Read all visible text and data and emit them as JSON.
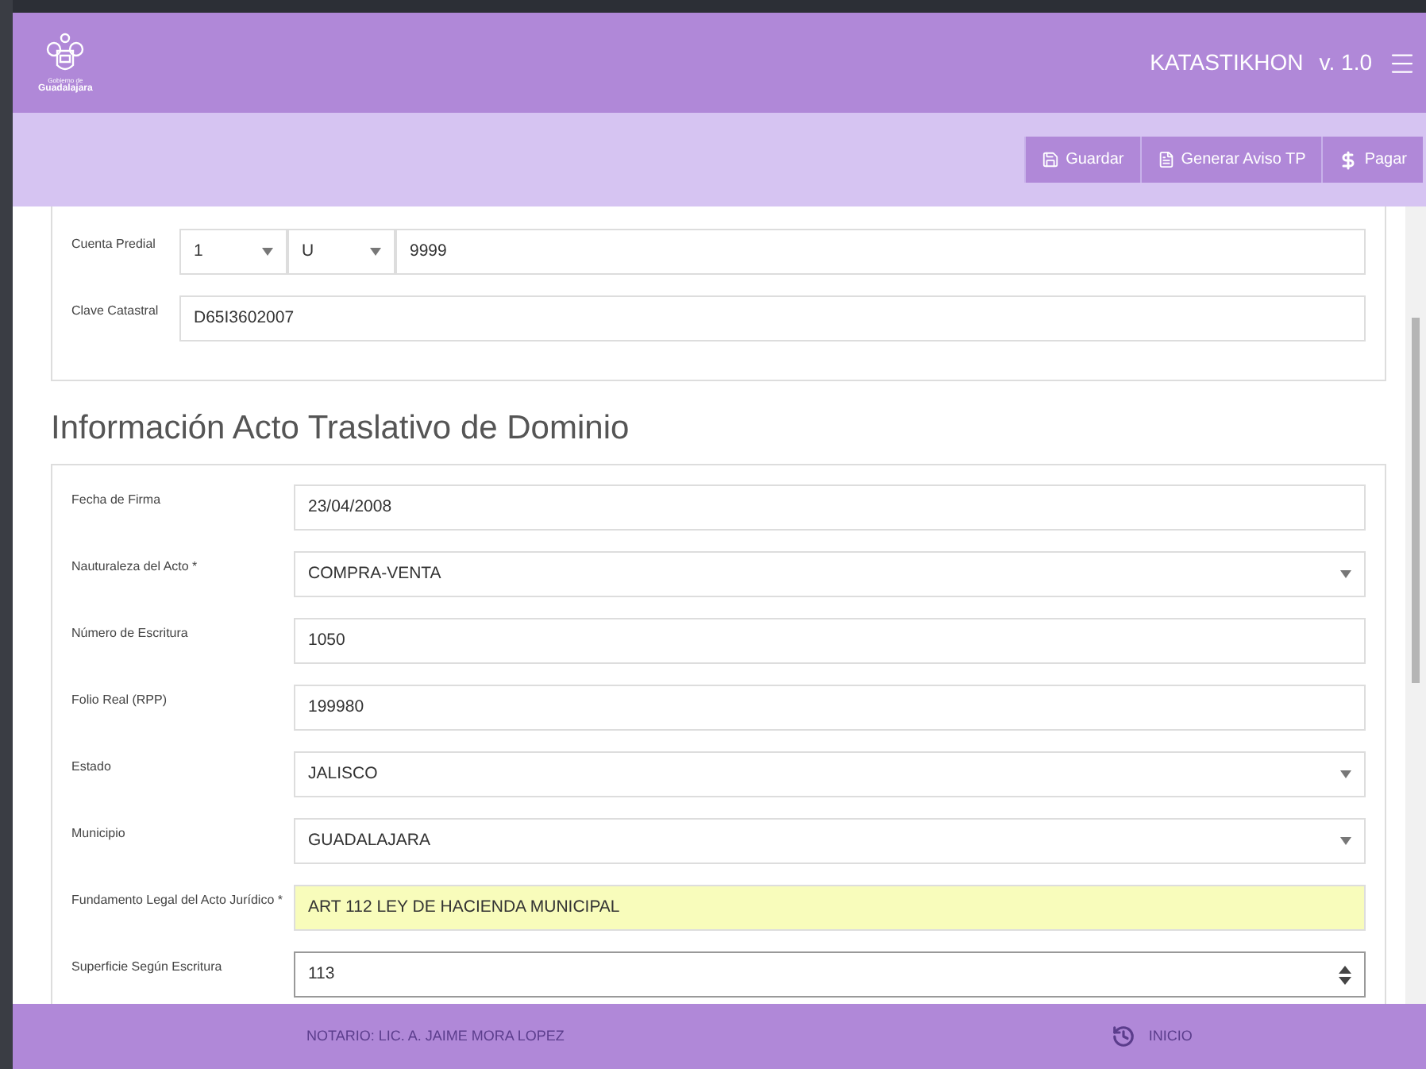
{
  "header": {
    "logo_text": [
      "Gobierno de",
      "Guadalajara"
    ],
    "title": "KATASTIKHON",
    "version": "v. 1.0"
  },
  "toolbar": {
    "buttons": [
      {
        "kind": "save",
        "label": "Guardar"
      },
      {
        "kind": "pdf",
        "label": "Generar Aviso TP"
      },
      {
        "kind": "pay",
        "label": "Pagar"
      }
    ]
  },
  "property_card": {
    "rows": [
      {
        "label": "Cuenta Predial",
        "parts": [
          {
            "kind": "select",
            "value": "1"
          },
          {
            "kind": "select",
            "value": "U"
          },
          {
            "kind": "text",
            "value": "9999"
          }
        ]
      },
      {
        "label": "Clave Catastral",
        "parts": [
          {
            "kind": "text",
            "value": "D65I3602007"
          }
        ]
      }
    ]
  },
  "section_title": "Información Acto Traslativo de Dominio",
  "act_card": {
    "fields": [
      {
        "label": "Fecha de Firma",
        "kind": "text",
        "value": "23/04/2008",
        "highlighted": false
      },
      {
        "label": "Nauturaleza del Acto *",
        "kind": "select",
        "value": "COMPRA-VENTA",
        "highlighted": false
      },
      {
        "label": "Número de Escritura",
        "kind": "text",
        "value": "1050",
        "highlighted": false
      },
      {
        "label": "Folio Real (RPP)",
        "kind": "text",
        "value": "199980",
        "highlighted": false
      },
      {
        "label": "Estado",
        "kind": "select",
        "value": "JALISCO",
        "highlighted": false
      },
      {
        "label": "Municipio",
        "kind": "select",
        "value": "GUADALAJARA",
        "highlighted": false
      },
      {
        "label": "Fundamento Legal del Acto Jurídico *",
        "kind": "text",
        "value": "ART 112 LEY DE HACIENDA MUNICIPAL",
        "highlighted": true
      },
      {
        "label": "Superficie Según Escritura",
        "kind": "number",
        "value": "113",
        "highlighted": false
      }
    ]
  },
  "footer": {
    "notary": "NOTARIO: LIC. A. JAIME MORA LOPEZ",
    "home_link": "INICIO"
  }
}
